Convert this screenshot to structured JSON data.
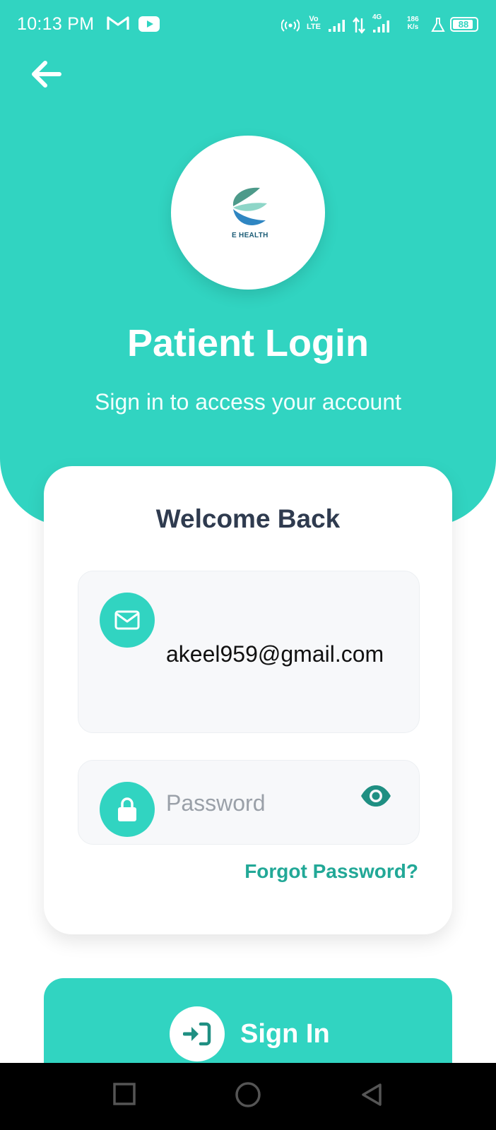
{
  "status_bar": {
    "time": "10:13 PM",
    "volte_top": "Vo",
    "volte_bottom": "LTE",
    "network": "4G",
    "speed_top": "186",
    "speed_bottom": "K/s",
    "battery": "88",
    "battery_level_percent": 88,
    "icons": [
      "gmail-icon",
      "youtube-icon",
      "hotspot-icon",
      "signal-icon",
      "data-arrows-icon",
      "battery-icon"
    ]
  },
  "header": {
    "back_icon": "arrow-left-icon",
    "logo_text": "E HEALTH",
    "title": "Patient Login",
    "subtitle": "Sign in to access your account"
  },
  "card": {
    "title": "Welcome Back",
    "email": {
      "icon": "mail-icon",
      "value": "akeel959@gmail.com"
    },
    "password": {
      "icon": "lock-icon",
      "placeholder": "Password",
      "toggle_icon": "eye-icon"
    },
    "forgot_password": "Forgot Password?"
  },
  "signin": {
    "label": "Sign In",
    "icon": "sign-in-icon"
  },
  "colors": {
    "primary": "#31d4c1",
    "link": "#22a897",
    "title_dark": "#2f3b4f"
  }
}
